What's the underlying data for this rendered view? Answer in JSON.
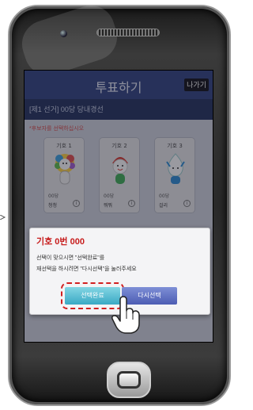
{
  "app": {
    "title": "투표하기",
    "exit_label": "나가기",
    "election_header": "[제1 선거] 00당 당내경선",
    "hint": "*후보자를 선택하십시오"
  },
  "candidates": [
    {
      "number": "기호 1",
      "party": "00당",
      "name": "청청",
      "info_icon": "info-icon",
      "mascot_color": "#3aa0e0"
    },
    {
      "number": "기호 2",
      "party": "00당",
      "name": "뭐뭐",
      "info_icon": "info-icon",
      "mascot_color": "#d9342b"
    },
    {
      "number": "기호 3",
      "party": "00당",
      "name": "걸리",
      "info_icon": "info-icon",
      "mascot_color": "#2a8bd6"
    }
  ],
  "dialog": {
    "title": "기호 0번 000",
    "line1": "선택이 맞으시면 \"선택완료\"를",
    "line2": "재선택을 하시려면 \"다시선택\"을 눌러주세요",
    "confirm_label": "선택완료",
    "reselect_label": "다시선택"
  },
  "icons": {
    "pointer": "hand-pointer-icon"
  },
  "colors": {
    "header_bg": "#2e4180",
    "alert_red": "#c71c1c",
    "confirm_btn": "#3aa9c4",
    "reselect_btn": "#4c5cb3"
  }
}
